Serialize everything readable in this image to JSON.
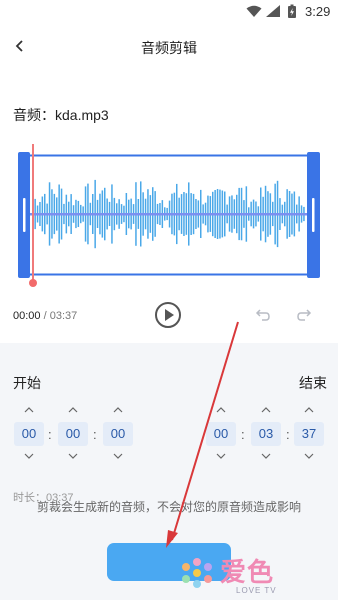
{
  "status_bar": {
    "time": "3:29"
  },
  "header": {
    "title": "音频剪辑"
  },
  "file": {
    "name": "音频：kda.mp3"
  },
  "playback": {
    "current": "00:00",
    "separator": " / ",
    "total": "03:37"
  },
  "trim": {
    "start_label": "开始",
    "end_label": "结束",
    "start": {
      "h": "00",
      "m": "00",
      "s": "00"
    },
    "end": {
      "h": "00",
      "m": "03",
      "s": "37"
    },
    "colon": ":"
  },
  "duration": "时长：03:37",
  "notice": "剪裁会生成新的音频，不会对您的原音频造成影响",
  "watermark": {
    "logo": "爱色",
    "sub": "LOVE TV"
  },
  "colors": {
    "accent": "#3a74e6",
    "wave": "#4aa8e8",
    "playhead": "#f07a7a",
    "button": "#4aa8f2"
  }
}
